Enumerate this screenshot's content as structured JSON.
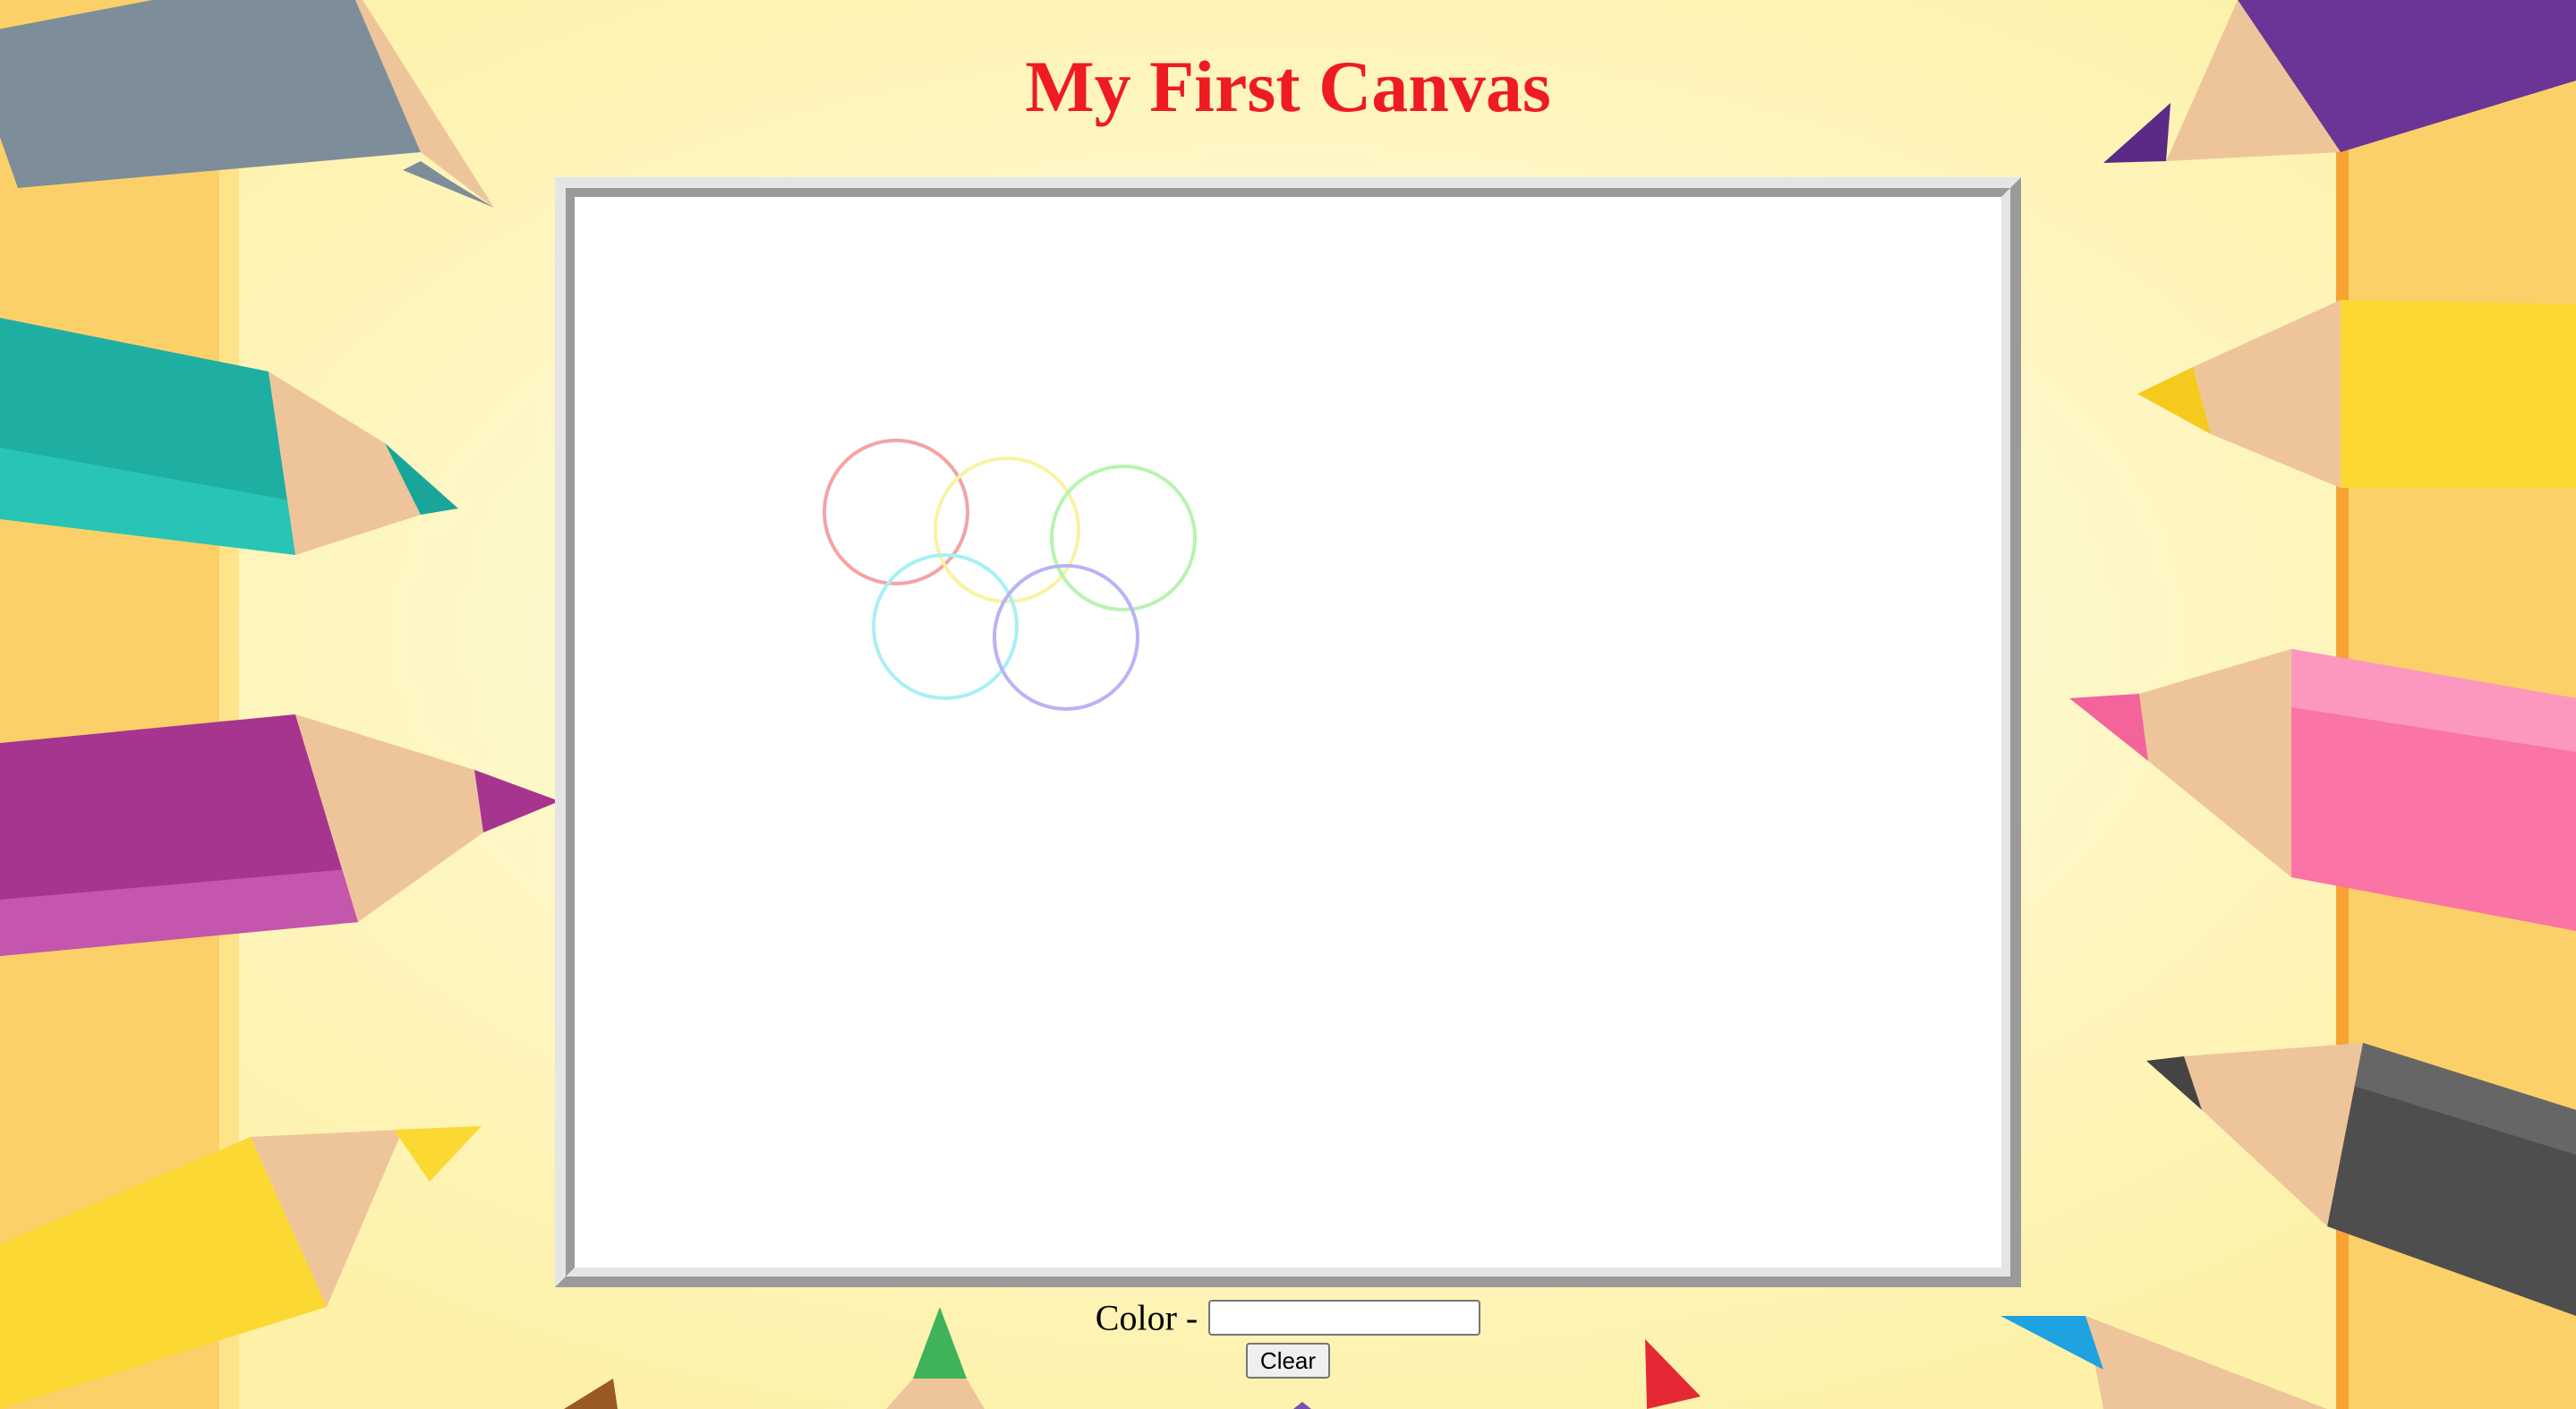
{
  "page": {
    "title": "My First Canvas"
  },
  "background": {
    "description_icon": "colored-pencils-frame",
    "colors": {
      "base": "#fef9c4",
      "stripe": "#fcc95b",
      "stripe_edge": "#f7a334"
    }
  },
  "canvas": {
    "circles": [
      {
        "name": "red-circle",
        "color": "#f5a3a3"
      },
      {
        "name": "yellow-circle",
        "color": "#f8f3a2"
      },
      {
        "name": "green-circle",
        "color": "#b8f3b0"
      },
      {
        "name": "cyan-circle",
        "color": "#a8f0f3"
      },
      {
        "name": "blue-circle",
        "color": "#b7b4f6"
      }
    ]
  },
  "controls": {
    "color_label": "Color -",
    "color_value": "",
    "clear_label": "Clear"
  },
  "colors": {
    "title": "#ee1b22"
  }
}
